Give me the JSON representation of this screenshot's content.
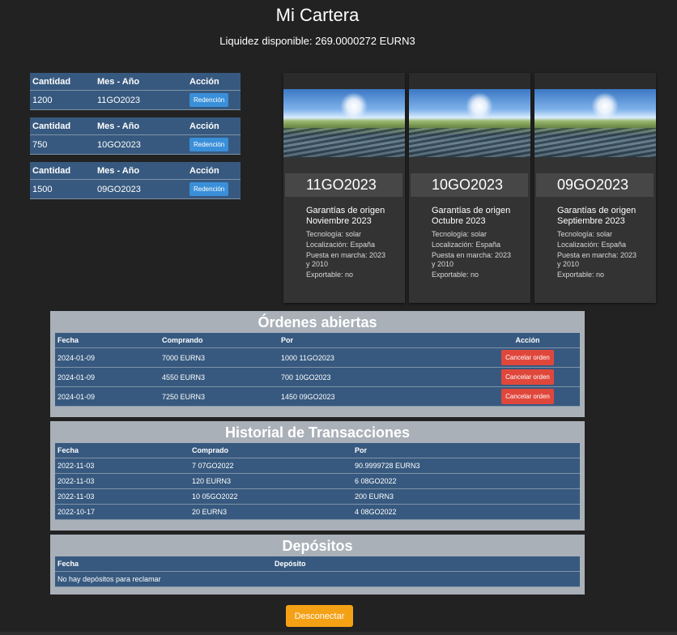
{
  "header": {
    "title": "Mi Cartera",
    "liquidity": "Liquidez disponible: 269.0000272 EURN3"
  },
  "holdings": {
    "headers": [
      "Cantidad",
      "Mes - Año",
      "Acción"
    ],
    "button_label": "Redención",
    "rows": [
      {
        "cantidad": "1200",
        "mes": "11GO2023"
      },
      {
        "cantidad": "750",
        "mes": "10GO2023"
      },
      {
        "cantidad": "1500",
        "mes": "09GO2023"
      }
    ]
  },
  "cards": [
    {
      "code": "11GO2023",
      "name": "Garantías de origen Noviembre 2023",
      "tech": "Tecnología: solar",
      "loc": "Localización: España",
      "start": "Puesta en marcha: 2023 y 2010",
      "export": "Exportable: no"
    },
    {
      "code": "10GO2023",
      "name": "Garantías de origen Octubre 2023",
      "tech": "Tecnología: solar",
      "loc": "Localización: España",
      "start": "Puesta en marcha: 2023 y 2010",
      "export": "Exportable: no"
    },
    {
      "code": "09GO2023",
      "name": "Garantías de origen Septiembre 2023",
      "tech": "Tecnología: solar",
      "loc": "Localización: España",
      "start": "Puesta en marcha: 2023 y 2010",
      "export": "Exportable: no"
    }
  ],
  "orders": {
    "title": "Órdenes abiertas",
    "headers": [
      "Fecha",
      "Comprando",
      "Por",
      "Acción"
    ],
    "button_label": "Cancelar orden",
    "rows": [
      {
        "fecha": "2024-01-09",
        "comprando": "7000 EURN3",
        "por": "1000 11GO2023"
      },
      {
        "fecha": "2024-01-09",
        "comprando": "4550 EURN3",
        "por": "700 10GO2023"
      },
      {
        "fecha": "2024-01-09",
        "comprando": "7250 EURN3",
        "por": "1450 09GO2023"
      }
    ]
  },
  "history": {
    "title": "Historial de Transacciones",
    "headers": [
      "Fecha",
      "Comprado",
      "Por"
    ],
    "rows": [
      {
        "fecha": "2022-11-03",
        "comprado": "7 07GO2022",
        "por": "90.9999728 EURN3"
      },
      {
        "fecha": "2022-11-03",
        "comprado": "120 EURN3",
        "por": "6 08GO2022"
      },
      {
        "fecha": "2022-11-03",
        "comprado": "10 05GO2022",
        "por": "200 EURN3"
      },
      {
        "fecha": "2022-10-17",
        "comprado": "20 EURN3",
        "por": "4 08GO2022"
      }
    ]
  },
  "deposits": {
    "title": "Depósitos",
    "headers": [
      "Fecha",
      "Depósito"
    ],
    "empty": "No hay depósitos para reclamar"
  },
  "footer": {
    "disconnect_label": "Desconectar"
  }
}
